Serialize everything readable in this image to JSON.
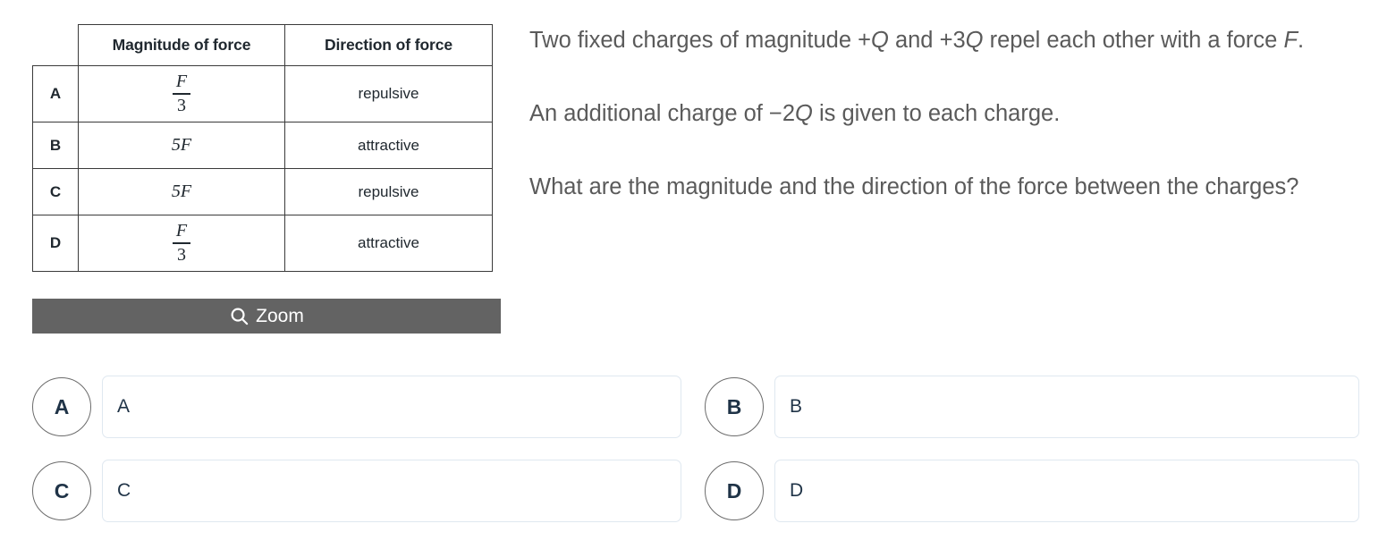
{
  "figure": {
    "table": {
      "columns": [
        "",
        "Magnitude of force",
        "Direction of force"
      ],
      "rows": [
        {
          "label": "A",
          "magnitude_numerator": "F",
          "magnitude_denominator": "3",
          "magnitude_plain": "",
          "direction": "repulsive"
        },
        {
          "label": "B",
          "magnitude_numerator": "",
          "magnitude_denominator": "",
          "magnitude_plain": "5F",
          "direction": "attractive"
        },
        {
          "label": "C",
          "magnitude_numerator": "",
          "magnitude_denominator": "",
          "magnitude_plain": "5F",
          "direction": "repulsive"
        },
        {
          "label": "D",
          "magnitude_numerator": "F",
          "magnitude_denominator": "3",
          "magnitude_plain": "",
          "direction": "attractive"
        }
      ]
    },
    "zoom_button": {
      "label": "Zoom",
      "icon": "search-icon",
      "background_color": "#636363",
      "text_color": "#ffffff"
    }
  },
  "stem": {
    "paragraphs": [
      {
        "parts": [
          {
            "text": "Two fixed charges of magnitude +",
            "italic": false
          },
          {
            "text": "Q",
            "italic": true
          },
          {
            "text": " and +3",
            "italic": false
          },
          {
            "text": "Q",
            "italic": true
          },
          {
            "text": " repel each other with a force ",
            "italic": false
          },
          {
            "text": "F",
            "italic": true
          },
          {
            "text": ".",
            "italic": false
          }
        ]
      },
      {
        "parts": [
          {
            "text": "An additional charge of −2",
            "italic": false
          },
          {
            "text": "Q",
            "italic": true
          },
          {
            "text": " is given to each charge.",
            "italic": false
          }
        ]
      },
      {
        "parts": [
          {
            "text": "What are the magnitude and the direction of the force between the charges?",
            "italic": false
          }
        ]
      }
    ],
    "text_color": "#5a5a5a"
  },
  "options": [
    {
      "letter": "A",
      "value": "A"
    },
    {
      "letter": "B",
      "value": "B"
    },
    {
      "letter": "C",
      "value": "C"
    },
    {
      "letter": "D",
      "value": "D"
    }
  ],
  "colors": {
    "option_letter": "#1f3347",
    "option_border": "#dfe8f0",
    "circle_border": "#6b6b6b",
    "table_border": "#3a3a3a"
  }
}
